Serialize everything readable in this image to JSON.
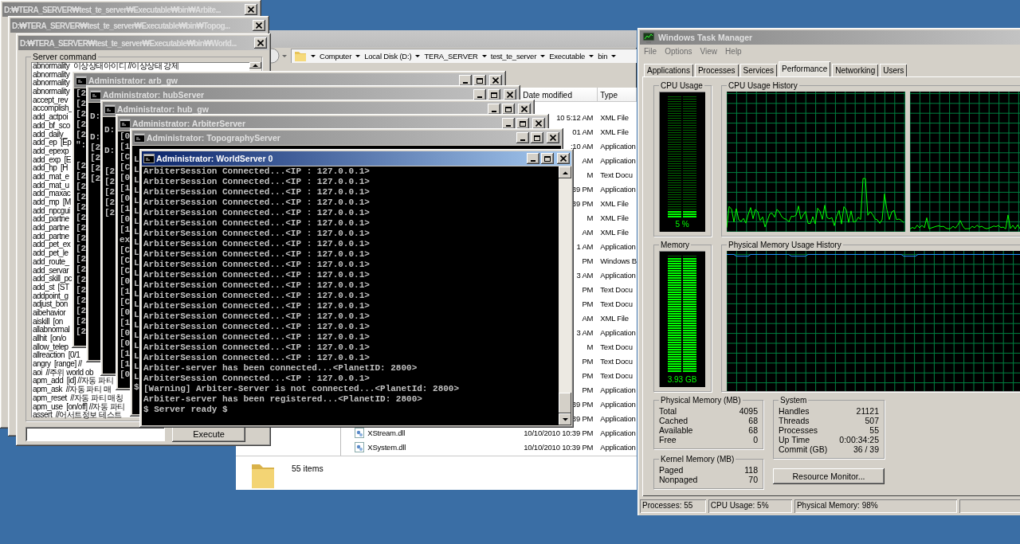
{
  "launcher_windows": [
    {
      "title": "D:₩TERA_SERVER₩test_te_server₩Executable₩bin₩Arbite..."
    },
    {
      "title": "D:₩TERA_SERVER₩test_te_server₩Executable₩bin₩Topog..."
    },
    {
      "title": "D:₩TERA_SERVER₩test_te_server₩Executable₩bin₩World..."
    }
  ],
  "server_command": {
    "group_label": "Server command",
    "commands": [
      "abnormality  이상상태아이디 //이상상태 강제",
      "abnormality",
      "abnormality",
      "abnormality",
      "accept_rev",
      "accomplish_",
      "add_actpoi",
      "add_bf_sco",
      "add_daily_",
      "add_ep  [Ep",
      "add_epexp",
      "add_exp  [E",
      "add_hp  [H",
      "add_mat_e",
      "add_mat_u",
      "add_maxac",
      "add_mp  [M",
      "add_npcgui",
      "add_partne",
      "add_partne",
      "add_partne",
      "add_pet_ex",
      "add_pet_le",
      "add_route_",
      "add_servar",
      "add_skill_pc",
      "add_st  [ST",
      "addpoint_g",
      "adjust_bon",
      "aibehavior",
      "aiskill  [on",
      "allabnormal",
      "allhit  [on/o",
      "allow_telep",
      "allreaction  [0/1",
      "angry  [range] //",
      "aoi  //주위 world ob",
      "apm_add  [id] //자동 파티",
      "apm_ask  //자동 파티 매",
      "apm_reset  //자동 파티 매칭",
      "apm_use  [on/off] //자동 파티",
      "assert  //어서트정보 테스트"
    ],
    "execute_button": "Execute"
  },
  "explorer": {
    "breadcrumbs": [
      "Computer",
      "Local Disk (D:)",
      "TERA_SERVER",
      "test_te_server",
      "Executable",
      "bin"
    ],
    "columns": [
      "Date modified",
      "Type"
    ],
    "rows": [
      {
        "date_modified": "10 5:12 AM",
        "type": "XML File"
      },
      {
        "date_modified": "01 AM",
        "type": "XML File"
      },
      {
        "date_modified": ":10 AM",
        "type": "Application"
      },
      {
        "date_modified": "AM",
        "type": "Application"
      },
      {
        "date_modified": "M",
        "type": "Text Docu"
      },
      {
        "date_modified": "39 PM",
        "type": "Application"
      },
      {
        "date_modified": "39 PM",
        "type": "XML File"
      },
      {
        "date_modified": "M",
        "type": "XML File"
      },
      {
        "date_modified": "AM",
        "type": "XML File"
      },
      {
        "date_modified": "1 AM",
        "type": "Application"
      },
      {
        "date_modified": "PM",
        "type": "Windows B"
      },
      {
        "date_modified": "3 AM",
        "type": "Application"
      },
      {
        "date_modified": "PM",
        "type": "Text Docu"
      },
      {
        "date_modified": "PM",
        "type": "Text Docu"
      },
      {
        "date_modified": "AM",
        "type": "XML File"
      },
      {
        "date_modified": "3 AM",
        "type": "Application"
      },
      {
        "date_modified": "M",
        "type": "Text Docu"
      },
      {
        "date_modified": "PM",
        "type": "Text Docu"
      },
      {
        "date_modified": "PM",
        "type": "Text Docu"
      },
      {
        "date_modified": "PM",
        "type": "Application"
      },
      {
        "date_modified": "39 PM",
        "type": "Application"
      },
      {
        "date_modified": "39 PM",
        "type": "Application"
      },
      {
        "name": "XStream.dll",
        "date_modified": "10/10/2010 10:39 PM",
        "type": "Application"
      },
      {
        "name": "XSystem.dll",
        "date_modified": "10/10/2010 10:39 PM",
        "type": "Application"
      }
    ],
    "status": "55 items"
  },
  "consoles": [
    {
      "title": "Administrator: arb_gw",
      "active": false,
      "blocks": [
        [
          "[2",
          "[2",
          "[2",
          "[2",
          "[2",
          "\":"
        ],
        [
          "[2",
          "[2",
          "[2",
          "[2",
          "[2",
          "[2",
          "[2",
          "[2",
          "[2",
          "[2",
          "[2",
          "[2",
          "[2",
          "[2",
          "[2",
          "[2",
          "[2"
        ]
      ]
    },
    {
      "title": "Administrator: hubServer",
      "active": false,
      "blocks": [
        [
          "D:"
        ],
        [
          "D:",
          "[2",
          "[2",
          "[2",
          "[2"
        ]
      ]
    },
    {
      "title": "Administrator: hub_gw",
      "active": false,
      "blocks": [
        [
          "D:"
        ],
        [
          "D:"
        ],
        [
          "[2",
          "[2",
          "[2",
          "[2",
          "[2"
        ]
      ]
    },
    {
      "title": "Administrator: ArbiterServer",
      "active": false,
      "blocks": [
        [
          "[0",
          "[1",
          "[C",
          "[C",
          "[0",
          "[1",
          "[0",
          "[1",
          "[0",
          "[1",
          "ex",
          "[C",
          "[C",
          "[C",
          "[0",
          "[1",
          "[C",
          "[0",
          "[1",
          "[0",
          "[0",
          "[1",
          "[1",
          "[0"
        ]
      ]
    },
    {
      "title": "Administrator: TopographyServer",
      "active": false,
      "blocks": [
        [
          "L",
          "L",
          "L",
          "L",
          "L",
          "L",
          "L",
          "L",
          "L",
          "L",
          "L",
          "L",
          "L",
          "L",
          "L",
          "L",
          "L",
          "L",
          "L",
          "L",
          "L",
          "L",
          "$"
        ]
      ]
    },
    {
      "title": "Administrator: WorldServer 0",
      "active": true,
      "blocks": [
        [
          "ArbiterSession Connected...<IP : 127.0.0.1>",
          "ArbiterSession Connected...<IP : 127.0.0.1>",
          "ArbiterSession Connected...<IP : 127.0.0.1>",
          "ArbiterSession Connected...<IP : 127.0.0.1>",
          "ArbiterSession Connected...<IP : 127.0.0.1>",
          "ArbiterSession Connected...<IP : 127.0.0.1>",
          "ArbiterSession Connected...<IP : 127.0.0.1>",
          "ArbiterSession Connected...<IP : 127.0.0.1>",
          "ArbiterSession Connected...<IP : 127.0.0.1>",
          "ArbiterSession Connected...<IP : 127.0.0.1>",
          "ArbiterSession Connected...<IP : 127.0.0.1>",
          "ArbiterSession Connected...<IP : 127.0.0.1>",
          "ArbiterSession Connected...<IP : 127.0.0.1>",
          "ArbiterSession Connected...<IP : 127.0.0.1>",
          "ArbiterSession Connected...<IP : 127.0.0.1>",
          "ArbiterSession Connected...<IP : 127.0.0.1>",
          "ArbiterSession Connected...<IP : 127.0.0.1>",
          "ArbiterSession Connected...<IP : 127.0.0.1>",
          "ArbiterSession Connected...<IP : 127.0.0.1>",
          "Arbiter-server has been connected...<PlanetID: 2800>",
          "ArbiterSession Connected...<IP : 127.0.0.1>",
          "[Warning] Arbiter-Server is not connected...<PlanetId: 2800>",
          "Arbiter-server has been registered...<PlanetID: 2800>",
          "$ Server ready $"
        ]
      ]
    }
  ],
  "task_manager": {
    "title": "Windows Task Manager",
    "menu": [
      "File",
      "Options",
      "View",
      "Help"
    ],
    "tabs": [
      {
        "label": "Applications",
        "selected": false
      },
      {
        "label": "Processes",
        "selected": false
      },
      {
        "label": "Services",
        "selected": false
      },
      {
        "label": "Performance",
        "selected": true
      },
      {
        "label": "Networking",
        "selected": false
      },
      {
        "label": "Users",
        "selected": false
      }
    ],
    "cpu_usage": {
      "label": "CPU Usage",
      "reading": "5 %",
      "level": 0.05
    },
    "cpu_history": {
      "label": "CPU Usage History"
    },
    "memory": {
      "label": "Memory",
      "reading": "3.93 GB",
      "level": 0.98
    },
    "memory_history": {
      "label": "Physical Memory Usage History"
    },
    "physical_memory": {
      "label": "Physical Memory (MB)",
      "rows": [
        {
          "name": "Total",
          "value": "4095"
        },
        {
          "name": "Cached",
          "value": "68"
        },
        {
          "name": "Available",
          "value": "68"
        },
        {
          "name": "Free",
          "value": "0"
        }
      ]
    },
    "kernel_memory": {
      "label": "Kernel Memory (MB)",
      "rows": [
        {
          "name": "Paged",
          "value": "118"
        },
        {
          "name": "Nonpaged",
          "value": "70"
        }
      ]
    },
    "system": {
      "label": "System",
      "rows": [
        {
          "name": "Handles",
          "value": "21121"
        },
        {
          "name": "Threads",
          "value": "507"
        },
        {
          "name": "Processes",
          "value": "55"
        },
        {
          "name": "Up Time",
          "value": "0:00:34:25"
        },
        {
          "name": "Commit (GB)",
          "value": "36 / 39"
        }
      ]
    },
    "resource_monitor_button": "Resource Monitor...",
    "status_bar": [
      "Processes: 55",
      "CPU Usage: 5%",
      "Physical Memory: 98%"
    ]
  }
}
